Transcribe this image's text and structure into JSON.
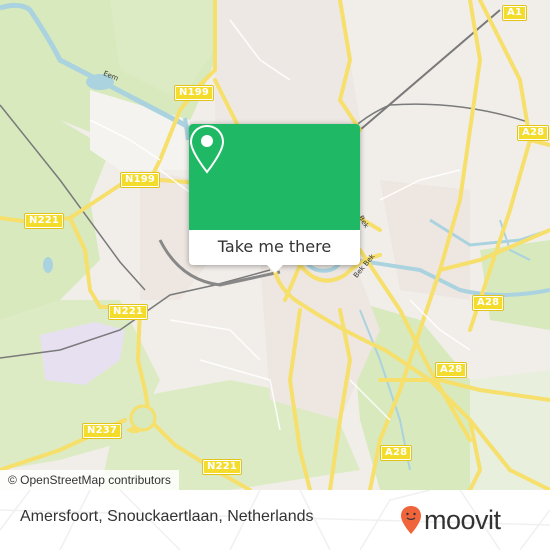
{
  "map": {
    "attribution": "© OpenStreetMap contributors",
    "place_labels": {
      "river_eem": "Eem",
      "road_fragment_1": "Bek",
      "road_fragment_2": "Bek  Bek"
    },
    "road_shields": [
      {
        "id": "a1",
        "label": "A1"
      },
      {
        "id": "n199-top",
        "label": "N199"
      },
      {
        "id": "a28-ne",
        "label": "A28"
      },
      {
        "id": "n199-mid",
        "label": "N199"
      },
      {
        "id": "n221-west",
        "label": "N221"
      },
      {
        "id": "n221-center",
        "label": "N221"
      },
      {
        "id": "a28-east",
        "label": "A28"
      },
      {
        "id": "a28-mid",
        "label": "A28"
      },
      {
        "id": "n237",
        "label": "N237"
      },
      {
        "id": "n221-south",
        "label": "N221"
      },
      {
        "id": "a28-south",
        "label": "A28"
      }
    ],
    "colors": {
      "land": "#f1eeea",
      "green": "#d7e9bd",
      "water": "#aad3df",
      "road": "#f6df6a",
      "shield": "#f4dc2c",
      "rail": "#777777"
    }
  },
  "popup": {
    "icon": "location-pin-icon",
    "action_label": "Take me there",
    "color": "#1fb966"
  },
  "footer": {
    "address": "Amersfoort, Snouckaertlaan, Netherlands",
    "brand": "moovit",
    "brand_color": "#f0643c"
  }
}
